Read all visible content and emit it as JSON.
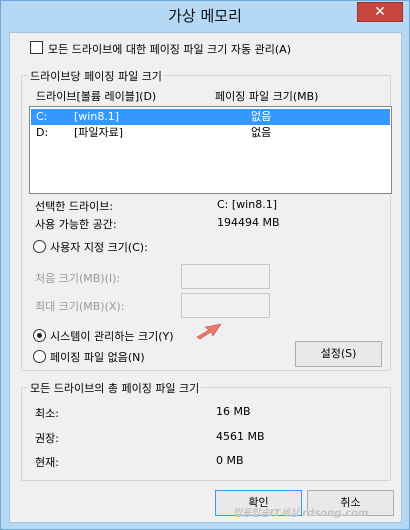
{
  "window": {
    "title": "가상 메모리",
    "close_glyph": "✕"
  },
  "auto_manage": {
    "label": "모든 드라이브에 대한 페이징 파일 크기 자동 관리(A)",
    "checked": false
  },
  "per_drive": {
    "group_title": "드라이브당 페이징 파일 크기",
    "columns": [
      "드라이브[볼륨 레이블](D)",
      "페이징 파일 크기(MB)"
    ],
    "drives": [
      {
        "letter": "C:",
        "label": "[win8.1]",
        "size": "없음",
        "selected": true
      },
      {
        "letter": "D:",
        "label": "[파일자료]",
        "size": "없음",
        "selected": false
      }
    ],
    "selected_drive_label": "선택한 드라이브:",
    "selected_drive_value": "C:  [win8.1]",
    "free_space_label": "사용 가능한 공간:",
    "free_space_value": "194494 MB",
    "custom_size_label": "사용자 지정 크기(C):",
    "initial_size_label": "처음 크기(MB)(I):",
    "initial_size_value": "",
    "max_size_label": "최대 크기(MB)(X):",
    "max_size_value": "",
    "system_managed_label": "시스템이 관리하는 크기(Y)",
    "no_paging_label": "페이징 파일 없음(N)",
    "set_button": "설정(S)",
    "selected_option": "system_managed"
  },
  "totals": {
    "group_title": "모든 드라이브의 총 페이징 파일 크기",
    "min_label": "최소:",
    "min_value": "16 MB",
    "recommended_label": "권장:",
    "recommended_value": "4561 MB",
    "current_label": "현재:",
    "current_value": "0 MB"
  },
  "footer": {
    "ok_button": "확인",
    "cancel_button": "취소"
  },
  "watermark": "밥동밥송IT세상 rdsong.com",
  "colors": {
    "selection": "#3399ff",
    "close_button": "#c7463e",
    "arrow": "#e8776f"
  }
}
